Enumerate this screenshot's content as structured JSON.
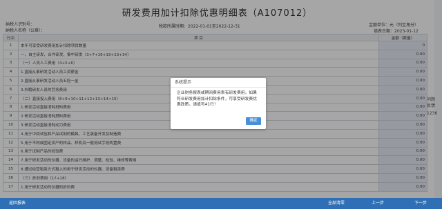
{
  "page": {
    "title": "研发费用加计扣除优惠明细表（A107012）",
    "taxpayer_id_label": "纳税人识别号：",
    "taxpayer_name_label": "纳税人名称（公章）：",
    "period": "税款所属时期：2022-01-01至2022-12-31",
    "unit": "金额单位：元（列至角分）",
    "fill_date": "填表日期：2023-01-12"
  },
  "table": {
    "headers": [
      "行次",
      "项      目",
      "金额（数量）"
    ],
    "rows": [
      {
        "no": "1",
        "item": "本年可享受研发费用加计扣除项目数量",
        "amount": "0"
      },
      {
        "no": "2",
        "item": "一、自主研发、合作研发、集中研发（3+7+16+19+23+34）",
        "amount": "0.00"
      },
      {
        "no": "3",
        "item": "（一）人员人工费用（4+5+6）",
        "amount": "0.00"
      },
      {
        "no": "4",
        "item": "1.直接从事研发活动人员工资薪金",
        "amount": "0.00"
      },
      {
        "no": "5",
        "item": "2.直接从事研发活动人员五险一金",
        "amount": "0.00"
      },
      {
        "no": "6",
        "item": "3.外聘研发人员的劳务费用",
        "amount": "0.00"
      },
      {
        "no": "7",
        "item": "（二）直接投入费用（8+9+10+11+12+13+14+15）",
        "amount": "0.00"
      },
      {
        "no": "8",
        "item": "1.研发活动直接消耗材料费用",
        "amount": "0.00"
      },
      {
        "no": "9",
        "item": "2.研发活动直接消耗燃料费用",
        "amount": "0.00"
      },
      {
        "no": "10",
        "item": "3.研发活动直接消耗动力费用",
        "amount": "0.00"
      },
      {
        "no": "11",
        "item": "4.用于中间试验和产品试制的模具、工艺装备开发及制造费",
        "amount": "0.00"
      },
      {
        "no": "12",
        "item": "5.用于不构成固定资产的样品、样机及一般测试手段购置费",
        "amount": "0.00"
      },
      {
        "no": "13",
        "item": "6.用于试制产品的检验费",
        "amount": "0.00"
      },
      {
        "no": "14",
        "item": "7.用于研发活动的仪器、设备的运行维护、调整、检验、维修等费用",
        "amount": "0.00"
      },
      {
        "no": "15",
        "item": "8.通过经营租赁方式租入的用于研发活动的仪器、设备租赁费",
        "amount": "0.00"
      },
      {
        "no": "16",
        "item": "（三）折旧费用（17+18）",
        "amount": "0.00"
      },
      {
        "no": "17",
        "item": "1.用于研发活动的仪器的折旧费",
        "amount": "0.00"
      }
    ]
  },
  "dialog": {
    "title": "系统提示",
    "message": "企业财务报表或期间费用表有研发费用，如果符合研发费用加计扣除条件，可享受研发费优惠政策，请填写41行！",
    "ok_label": "确定"
  },
  "side": {
    "help_label": "问题",
    "feedback_label": "反馈",
    "number": "1236"
  },
  "bottom": {
    "back_label": "返回报表",
    "clear_label": "全部清零",
    "prev_label": "上一步",
    "next_label": "下一步"
  },
  "colors": {
    "bottom_bar": "#2f6fb5",
    "ok_button": "#4a90d9",
    "amount_cell": "#e6ebf4"
  }
}
